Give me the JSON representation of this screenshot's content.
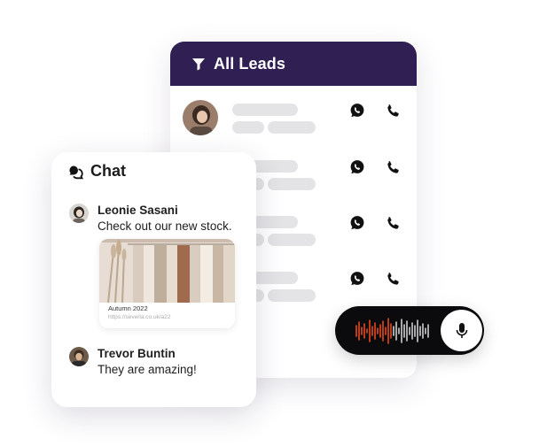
{
  "leads": {
    "title": "All Leads",
    "header_color": "#2f1f52",
    "rows": [
      {
        "whatsapp_icon": "whatsapp-icon",
        "phone_icon": "phone-icon"
      },
      {
        "whatsapp_icon": "whatsapp-icon",
        "phone_icon": "phone-icon"
      },
      {
        "whatsapp_icon": "whatsapp-icon",
        "phone_icon": "phone-icon"
      },
      {
        "whatsapp_icon": "whatsapp-icon",
        "phone_icon": "phone-icon"
      }
    ]
  },
  "chat": {
    "title": "Chat",
    "messages": [
      {
        "name": "Leonie Sasani",
        "text": "Check out our new stock."
      },
      {
        "name": "Trevor Buntin",
        "text": "They are amazing!"
      }
    ],
    "link_preview": {
      "title": "Autumn 2022",
      "url": "https://severla.co.uk/a22"
    }
  },
  "voice": {
    "mic_icon": "mic-icon",
    "accent_color": "#e8491d"
  }
}
